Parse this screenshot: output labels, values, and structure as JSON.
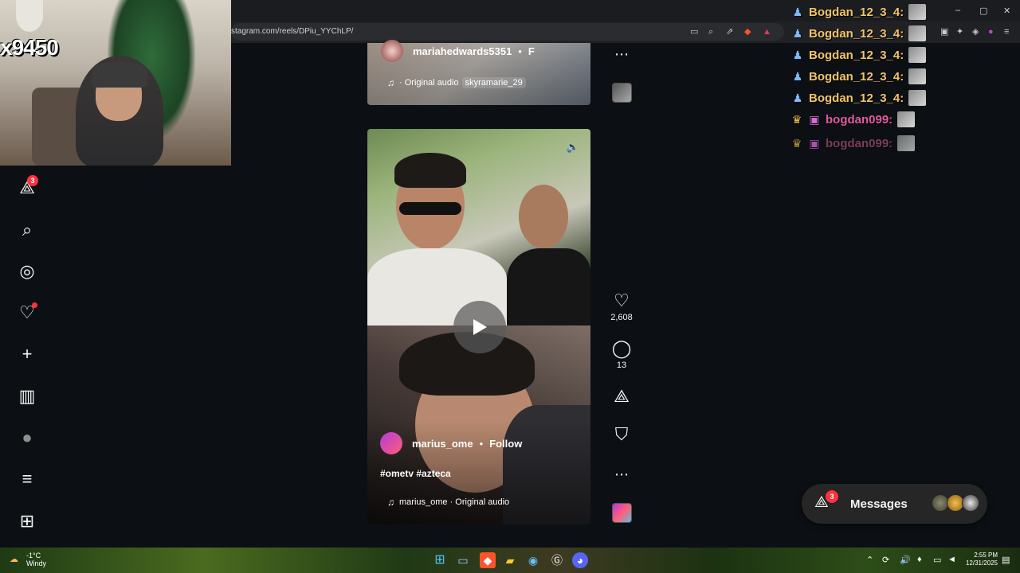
{
  "browser": {
    "url": "stagram.com/reels/DPiu_YYChLP/",
    "window_controls": [
      "–",
      "▢",
      "✕"
    ]
  },
  "webcam": {
    "overlay_text": "x9450"
  },
  "sidebar": {
    "items": [
      {
        "name": "messages",
        "icon": "send-icon",
        "glyph": "⟁",
        "badge": "3"
      },
      {
        "name": "search",
        "icon": "search-icon",
        "glyph": "⌕"
      },
      {
        "name": "explore",
        "icon": "compass-icon",
        "glyph": "◎"
      },
      {
        "name": "notifications",
        "icon": "heart-icon",
        "glyph": "♡",
        "dot": true
      },
      {
        "name": "create",
        "icon": "plus-icon",
        "glyph": "+"
      },
      {
        "name": "dashboard",
        "icon": "chart-icon",
        "glyph": "▥"
      },
      {
        "name": "profile",
        "icon": "avatar-icon",
        "glyph": "●"
      },
      {
        "name": "more",
        "icon": "menu-icon",
        "glyph": "≡"
      },
      {
        "name": "apps",
        "icon": "apps-icon",
        "glyph": "⊞"
      }
    ]
  },
  "reel_top": {
    "author": "mariahedwards5351",
    "follow_partial": "F",
    "audio": "· Original audio",
    "audio_user": "skyramarie_29"
  },
  "reel_main": {
    "author": "marius_ome",
    "follow": "Follow",
    "caption": "#ometv #azteca",
    "audio": "marius_ome · Original audio"
  },
  "actions": {
    "likes": "2,608",
    "comments": "13"
  },
  "chat": [
    {
      "user": "Bogdan_12_3_4:",
      "color": "#f2c46a",
      "badge": "♟"
    },
    {
      "user": "Bogdan_12_3_4:",
      "color": "#f2c46a",
      "badge": "♟"
    },
    {
      "user": "Bogdan_12_3_4:",
      "color": "#f2c46a",
      "badge": "♟"
    },
    {
      "user": "Bogdan_12_3_4:",
      "color": "#f2c46a",
      "badge": "♟"
    },
    {
      "user": "Bogdan_12_3_4:",
      "color": "#f2c46a",
      "badge": "♟"
    },
    {
      "user": "bogdan099:",
      "color": "#e45aa2",
      "badge": "♛"
    },
    {
      "user": "bogdan099:",
      "color": "#a04b78",
      "badge": "♛"
    }
  ],
  "messages_panel": {
    "label": "Messages",
    "badge": "3"
  },
  "taskbar": {
    "temp": "-1°C",
    "condition": "Windy",
    "time": "2:55 PM",
    "date": "12/31/2025"
  }
}
